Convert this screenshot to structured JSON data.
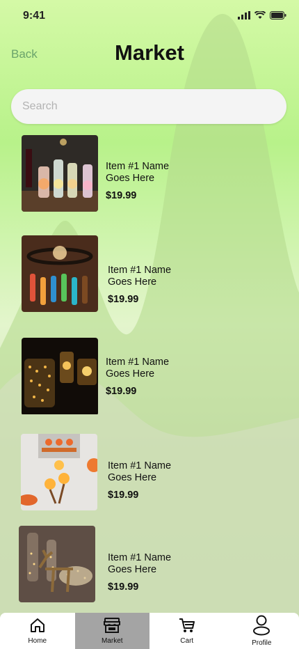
{
  "status": {
    "time": "9:41"
  },
  "header": {
    "back_label": "Back",
    "title": "Market"
  },
  "search": {
    "placeholder": "Search",
    "value": ""
  },
  "items": [
    {
      "name": "Item #1 Name Goes Here",
      "price": "$19.99",
      "image": "bottle-lights-image"
    },
    {
      "name": "Item #1 Name Goes Here",
      "price": "$19.99",
      "image": "bottle-chandelier-image"
    },
    {
      "name": "Item #1 Name Goes Here",
      "price": "$19.99",
      "image": "tin-can-lanterns-image"
    },
    {
      "name": "Item #1 Name Goes Here",
      "price": "$19.99",
      "image": "tulip-lamps-image"
    },
    {
      "name": "Item #1 Name Goes Here",
      "price": "$19.99",
      "image": "reindeer-bottle-lights-image"
    }
  ],
  "tabs": [
    {
      "label": "Home",
      "icon": "home-icon",
      "active": false
    },
    {
      "label": "Market",
      "icon": "store-icon",
      "active": true
    },
    {
      "label": "Cart",
      "icon": "cart-icon",
      "active": false
    },
    {
      "label": "Profile",
      "icon": "profile-icon",
      "active": false
    }
  ],
  "colors": {
    "accent": "#6aa36b",
    "tab_active_bg": "#a4a4a4",
    "bg_top": "#d4f9a6"
  }
}
